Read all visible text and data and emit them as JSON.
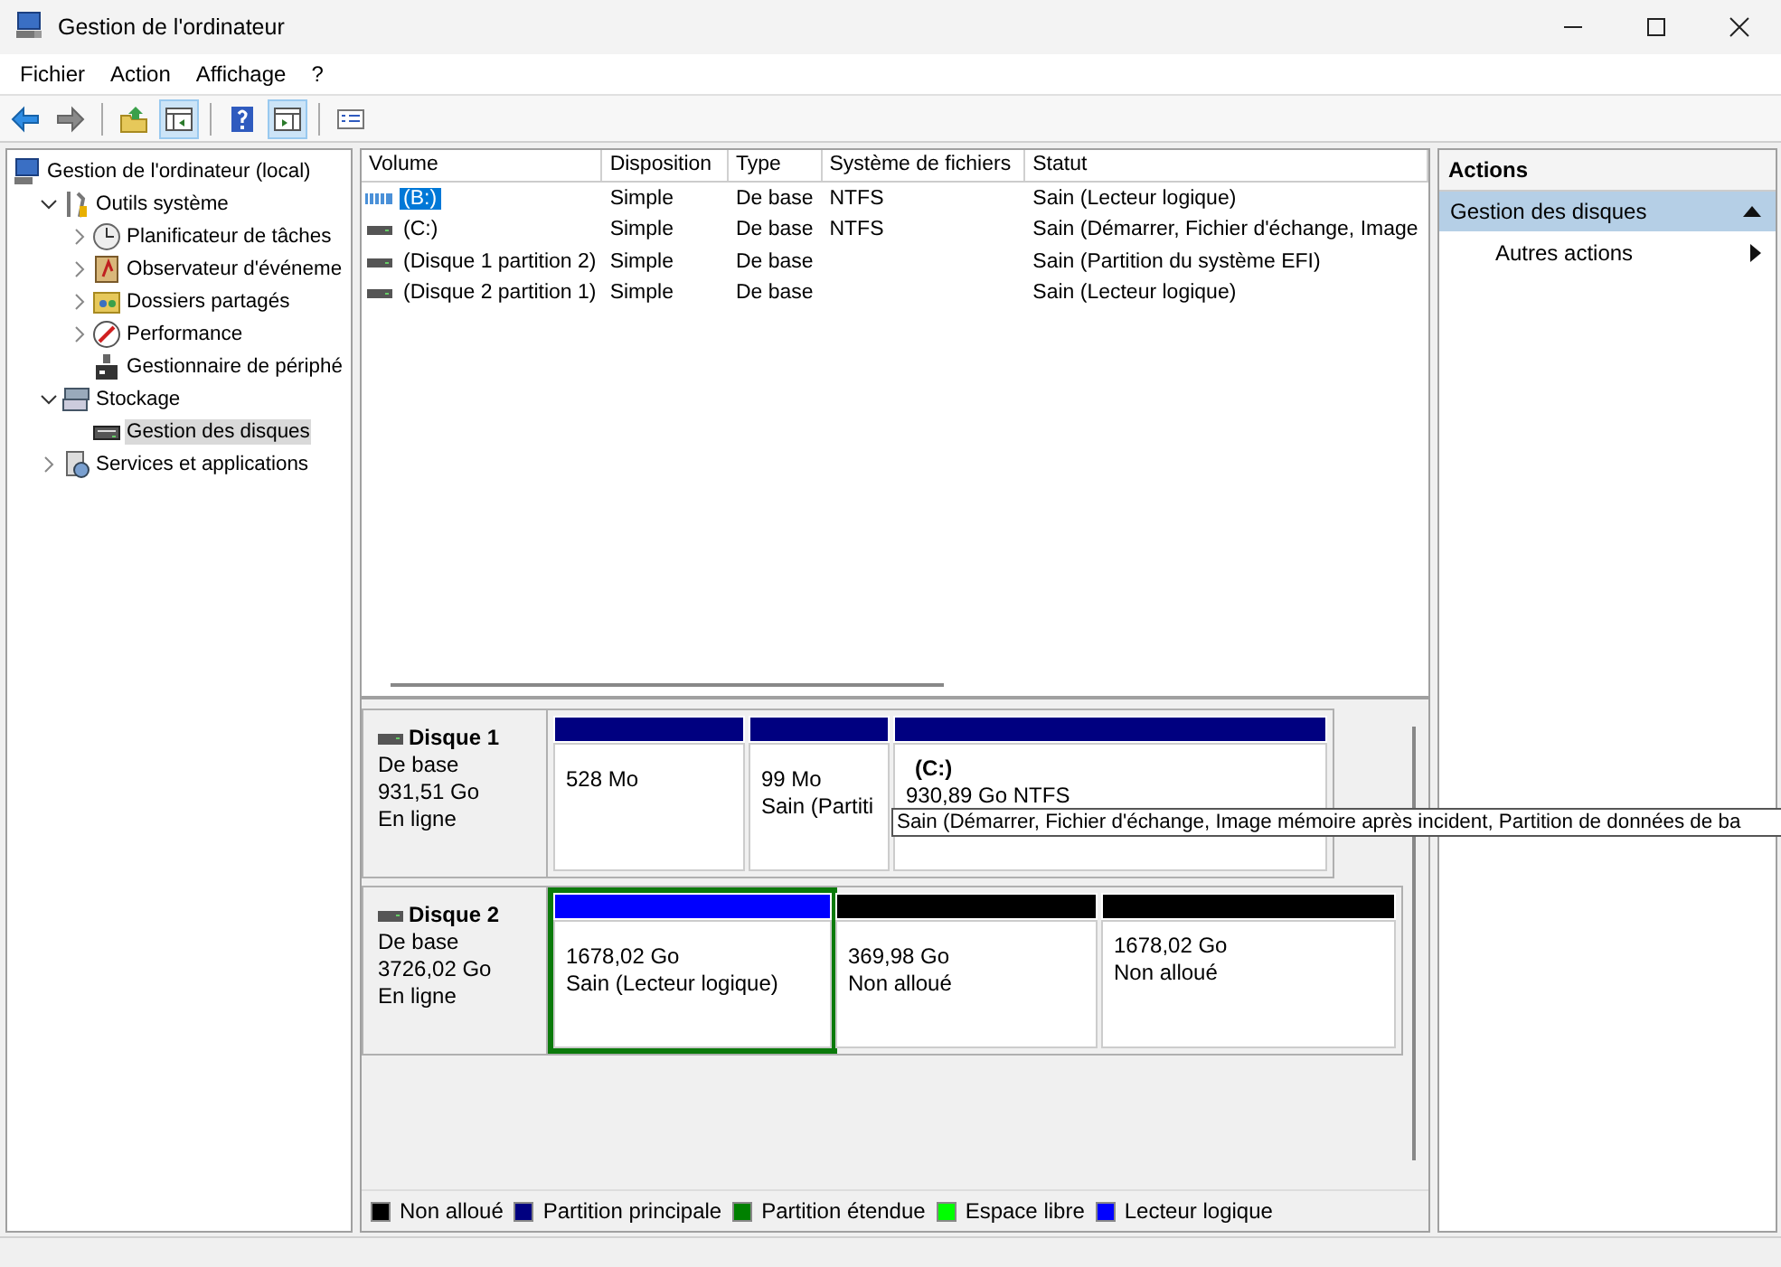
{
  "window": {
    "title": "Gestion de l'ordinateur"
  },
  "menu": [
    "Fichier",
    "Action",
    "Affichage",
    "?"
  ],
  "toolbar": [
    {
      "kind": "back",
      "pressed": false
    },
    {
      "kind": "forward",
      "pressed": false
    },
    {
      "kind": "sep"
    },
    {
      "kind": "up",
      "pressed": false
    },
    {
      "kind": "tree",
      "pressed": true
    },
    {
      "kind": "sep"
    },
    {
      "kind": "help",
      "pressed": false
    },
    {
      "kind": "pane",
      "pressed": true
    },
    {
      "kind": "sep"
    },
    {
      "kind": "props",
      "pressed": false
    }
  ],
  "tree": [
    {
      "label": "Gestion de l'ordinateur (local)",
      "selected": false,
      "children": [
        {
          "label": "Outils système",
          "expanded": true,
          "selected": false,
          "children": [
            {
              "label": "Planificateur de tâches",
              "expanded": false,
              "selected": false
            },
            {
              "label": "Observateur d'événeme",
              "expanded": false,
              "selected": false
            },
            {
              "label": "Dossiers partagés",
              "expanded": false,
              "selected": false
            },
            {
              "label": "Performance",
              "expanded": false,
              "selected": false
            },
            {
              "label": "Gestionnaire de périphé",
              "selected": false
            }
          ]
        },
        {
          "label": "Stockage",
          "expanded": true,
          "selected": false,
          "children": [
            {
              "label": "Gestion des disques",
              "selected": true
            }
          ]
        },
        {
          "label": "Services et applications",
          "expanded": false,
          "selected": false
        }
      ]
    }
  ],
  "volumes": {
    "columns": [
      "Volume",
      "Disposition",
      "Type",
      "Système de fichiers",
      "Statut"
    ],
    "rows": [
      {
        "kind": "logical",
        "selected": true,
        "cells": [
          "(B:)",
          "Simple",
          "De base",
          "NTFS",
          "Sain (Lecteur logique)"
        ]
      },
      {
        "kind": "basic",
        "selected": false,
        "cells": [
          "(C:)",
          "Simple",
          "De base",
          "NTFS",
          "Sain (Démarrer, Fichier d'échange, Image"
        ]
      },
      {
        "kind": "basic",
        "selected": false,
        "cells": [
          "(Disque 1 partition 2)",
          "Simple",
          "De base",
          "",
          "Sain (Partition du système EFI)"
        ]
      },
      {
        "kind": "basic",
        "selected": false,
        "cells": [
          "(Disque 2 partition 1)",
          "Simple",
          "De base",
          "",
          "Sain (Lecteur logique)"
        ]
      }
    ]
  },
  "disks": [
    {
      "name": "Disque 1",
      "lines": [
        "De base",
        "931,51 Go",
        "En ligne"
      ],
      "partitions": [
        {
          "color": "#000080",
          "selected": false,
          "lines": [
            "528 Mo"
          ]
        },
        {
          "color": "#000080",
          "selected": false,
          "lines": [
            "99 Mo",
            "Sain (Partiti"
          ]
        },
        {
          "color": "#000080",
          "selected": false,
          "title": "(C:)",
          "lines": [
            "930,89 Go NTFS"
          ]
        }
      ]
    },
    {
      "name": "Disque 2",
      "lines": [
        "De base",
        "3726,02 Go",
        "En ligne"
      ],
      "partitions": [
        {
          "color": "#0000ff",
          "selected": true,
          "lines": [
            "1678,02 Go",
            "Sain (Lecteur logique)"
          ]
        },
        {
          "color": "#000000",
          "selected": false,
          "lines": [
            "369,98 Go",
            "Non alloué"
          ]
        },
        {
          "color": "#000000",
          "selected": false,
          "lines": [
            "1678,02 Go",
            "Non alloué"
          ]
        }
      ]
    }
  ],
  "tooltip": "Sain (Démarrer, Fichier d'échange, Image mémoire après incident, Partition de données de ba",
  "legend": [
    {
      "label": "Non alloué",
      "color": "#000000"
    },
    {
      "label": "Partition principale",
      "color": "#000080"
    },
    {
      "label": "Partition étendue",
      "color": "#008000"
    },
    {
      "label": "Espace libre",
      "color": "#00ff00"
    },
    {
      "label": "Lecteur logique",
      "color": "#0000ff"
    }
  ],
  "actions": {
    "header": "Actions",
    "section": {
      "label": "Gestion des disques",
      "expanded": true
    },
    "items": [
      "Autres actions"
    ]
  }
}
